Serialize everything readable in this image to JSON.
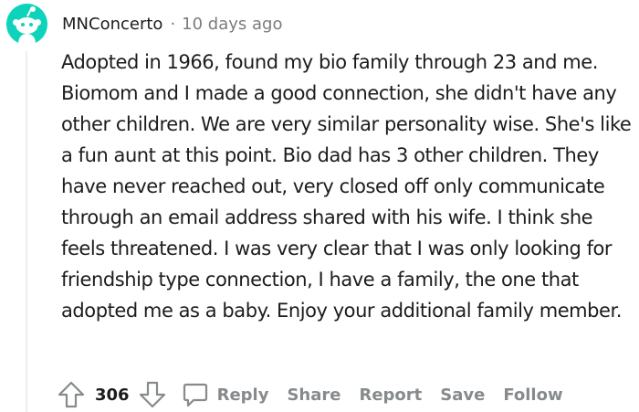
{
  "comment": {
    "username": "MNConcerto",
    "separator": "·",
    "timestamp": "10 days ago",
    "body": "Adopted in 1966, found my bio family through 23 and me. Biomom and I made a good connection, she didn't have any other children. We are very similar personality wise. She's like a fun aunt at this point. Bio dad has 3 other children. They have never reached out, very closed off only communicate through an email address shared with his wife. I think she feels threatened. I was very clear that I was only looking for friendship type connection, I have a family, the one that adopted me as a baby. Enjoy your additional family member.",
    "avatar_icon": "snoo-avatar-icon",
    "avatar_color": "#0dd3bb"
  },
  "actions": {
    "upvote_icon": "upvote-arrow-icon",
    "vote_count": "306",
    "downvote_icon": "downvote-arrow-icon",
    "reply_icon": "speech-bubble-icon",
    "reply_label": "Reply",
    "share_label": "Share",
    "report_label": "Report",
    "save_label": "Save",
    "follow_label": "Follow"
  },
  "colors": {
    "text_primary": "#1c1c1c",
    "text_muted": "#7c7c7c",
    "action_gray": "#878a8c",
    "thread_line": "#edeff1"
  }
}
